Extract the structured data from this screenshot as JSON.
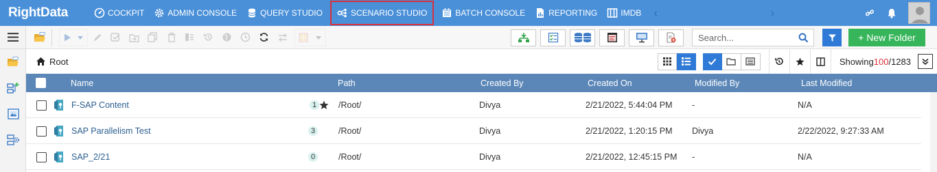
{
  "app": {
    "logo_text": "RightData"
  },
  "nav": {
    "items": [
      {
        "label": "COCKPIT",
        "icon": "speedometer-icon"
      },
      {
        "label": "ADMIN CONSOLE",
        "icon": "gear-icon"
      },
      {
        "label": "QUERY STUDIO",
        "icon": "database-icon"
      },
      {
        "label": "SCENARIO STUDIO",
        "icon": "scenario-icon",
        "active": true
      },
      {
        "label": "BATCH CONSOLE",
        "icon": "batch-icon"
      },
      {
        "label": "REPORTING",
        "icon": "report-icon"
      },
      {
        "label": "IMDB",
        "icon": "imdb-icon"
      }
    ],
    "prev_arrow": "‹",
    "next_arrow": "›"
  },
  "search": {
    "placeholder": "Search...",
    "value": ""
  },
  "toolbar": {
    "new_folder_label": "+ New Folder"
  },
  "breadcrumb": {
    "root_label": "Root"
  },
  "showing": {
    "prefix": "Showing ",
    "count": "100",
    "separator": " / ",
    "total": "1283"
  },
  "table": {
    "columns": {
      "name": "Name",
      "path": "Path",
      "created_by": "Created By",
      "created_on": "Created On",
      "modified_by": "Modified By",
      "last_modified": "Last Modified"
    },
    "rows": [
      {
        "name": "F-SAP Content",
        "badge": "1",
        "starred": true,
        "path": "/Root/",
        "created_by": "Divya",
        "created_on": "2/21/2022, 5:44:04 PM",
        "modified_by": "-",
        "last_modified": "N/A"
      },
      {
        "name": "SAP Parallelism Test",
        "badge": "3",
        "starred": false,
        "path": "/Root/",
        "created_by": "Divya",
        "created_on": "2/21/2022, 1:20:15 PM",
        "modified_by": "Divya",
        "last_modified": "2/22/2022, 9:27:33 AM"
      },
      {
        "name": "SAP_2/21",
        "badge": "0",
        "starred": false,
        "path": "/Root/",
        "created_by": "Divya",
        "created_on": "2/21/2022, 12:45:15 PM",
        "modified_by": "-",
        "last_modified": "N/A"
      }
    ]
  },
  "colors": {
    "nav_bg": "#4a90d9",
    "active_border": "#d9303a",
    "header_bg": "#5b87b8",
    "new_folder_bg": "#36b55a",
    "primary_blue": "#2f7ad6",
    "count_red": "#d9303a"
  }
}
